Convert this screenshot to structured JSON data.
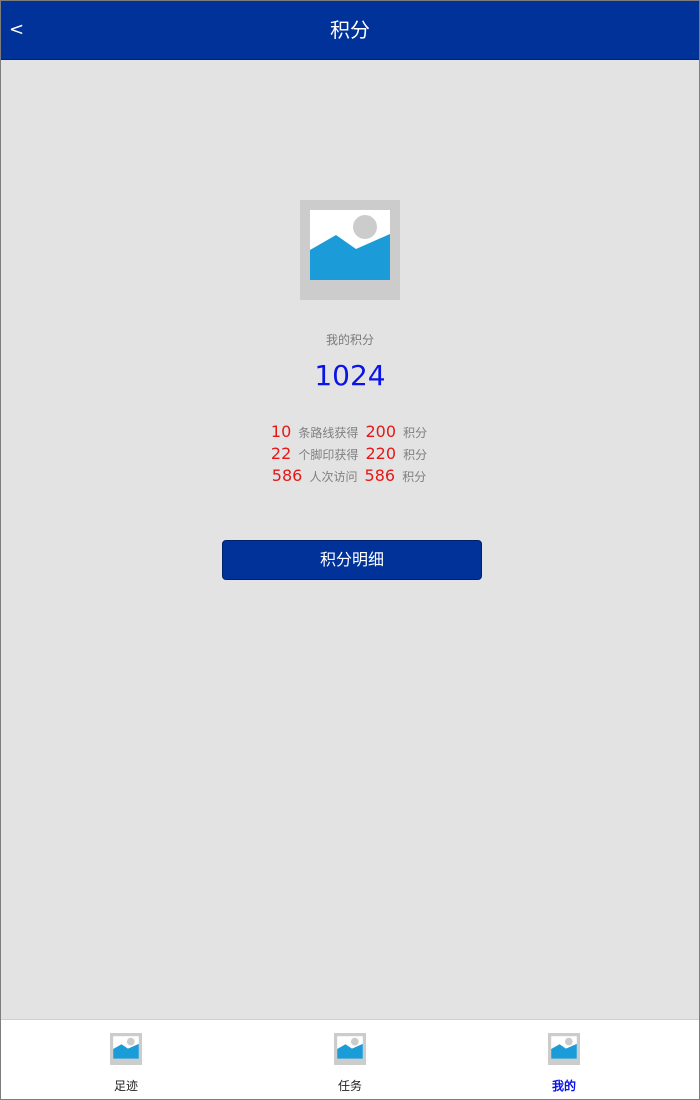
{
  "header": {
    "back_label": "<",
    "title": "积分"
  },
  "profile": {
    "avatar_icon": "image-placeholder-icon",
    "points_label": "我的积分",
    "points_value": "1024"
  },
  "stats": [
    {
      "count": "10",
      "desc": "条路线获得",
      "points": "200",
      "unit": "积分"
    },
    {
      "count": "22",
      "desc": "个脚印获得",
      "points": "220",
      "unit": "积分"
    },
    {
      "count": "586",
      "desc": "人次访问",
      "points": "586",
      "unit": "积分"
    }
  ],
  "detail_button_label": "积分明细",
  "tabs": [
    {
      "label": "足迹",
      "icon": "image-placeholder-icon",
      "active": false
    },
    {
      "label": "任务",
      "icon": "image-placeholder-icon",
      "active": false
    },
    {
      "label": "我的",
      "icon": "image-placeholder-icon",
      "active": true
    }
  ],
  "colors": {
    "header_bg": "#00329a",
    "points_color": "#0a14e8",
    "highlight_red": "#e61717",
    "page_bg": "#e3e3e3"
  }
}
